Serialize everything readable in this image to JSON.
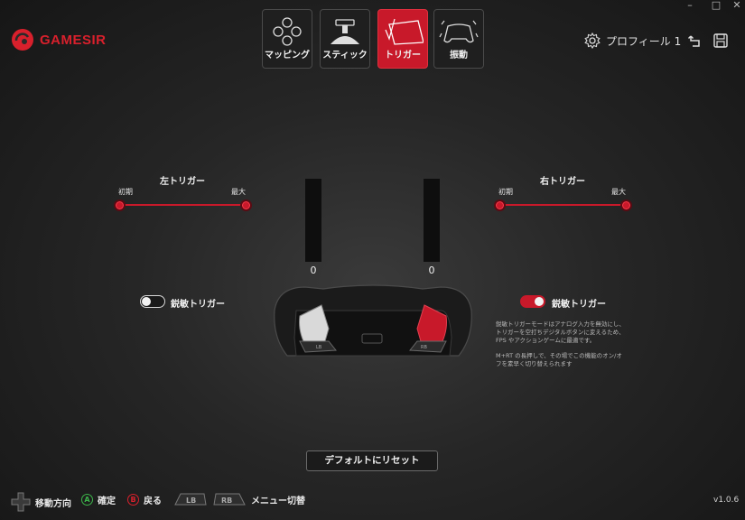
{
  "window": {
    "minimize": "–",
    "maximize": "□",
    "close": "✕"
  },
  "brand": {
    "name": "GAMESIR",
    "color": "#d8202c"
  },
  "tabs": [
    {
      "label": "マッピング",
      "icon": "dpad-buttons-icon",
      "active": false
    },
    {
      "label": "スティック",
      "icon": "joystick-icon",
      "active": false
    },
    {
      "label": "トリガー",
      "icon": "trigger-icon",
      "active": true
    },
    {
      "label": "振動",
      "icon": "vibration-controller-icon",
      "active": false
    }
  ],
  "profile": {
    "label": "プロフィール 1",
    "icon": "gear-icon"
  },
  "left_trigger": {
    "title": "左トリガー",
    "min_label": "初期",
    "max_label": "最大",
    "bar_value": "0",
    "sensitive_label": "鋭敏トリガー",
    "sensitive_on": false
  },
  "right_trigger": {
    "title": "右トリガー",
    "min_label": "初期",
    "max_label": "最大",
    "bar_value": "0",
    "sensitive_label": "鋭敏トリガー",
    "sensitive_on": true
  },
  "description": {
    "line1": "鋭敏トリガーモードはアナログ入力を無効にし、",
    "line2": "トリガーを空打ちデジタルボタンに変えるため、",
    "line3": "FPS やアクションゲームに最適です。",
    "line4": "M+RT の長押しで、その場でこの機能のオン/オ",
    "line5": "フを素早く切り替えられます"
  },
  "controller": {
    "lb_label": "LB",
    "rb_label": "RB"
  },
  "reset_label": "デフォルトにリセット",
  "footer": {
    "move_label": "移動方向",
    "a_glyph": "A",
    "confirm_label": "確定",
    "b_glyph": "B",
    "back_label": "戻る",
    "lb_glyph": "LB",
    "rb_glyph": "RB",
    "menu_label": "メニュー切替"
  },
  "version": "v1.0.6",
  "colors": {
    "accent": "#c8192a",
    "a_button": "#3cb44a",
    "b_button": "#d8202c"
  }
}
